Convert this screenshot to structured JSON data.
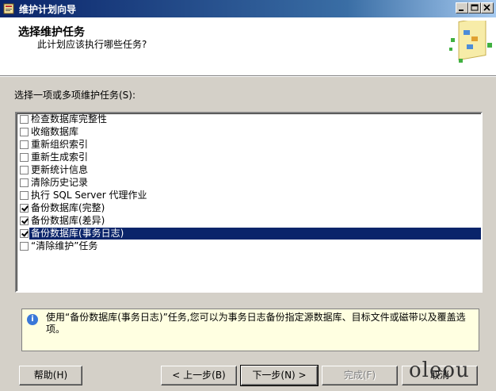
{
  "window": {
    "title": "维护计划向导"
  },
  "header": {
    "title": "选择维护任务",
    "subtitle": "此计划应该执行哪些任务?"
  },
  "section_label": "选择一项或多项维护任务(S):",
  "tasks": [
    {
      "label": "检查数据库完整性",
      "checked": false,
      "selected": false
    },
    {
      "label": "收缩数据库",
      "checked": false,
      "selected": false
    },
    {
      "label": "重新组织索引",
      "checked": false,
      "selected": false
    },
    {
      "label": "重新生成索引",
      "checked": false,
      "selected": false
    },
    {
      "label": "更新统计信息",
      "checked": false,
      "selected": false
    },
    {
      "label": "清除历史记录",
      "checked": false,
      "selected": false
    },
    {
      "label": "执行 SQL Server 代理作业",
      "checked": false,
      "selected": false
    },
    {
      "label": "备份数据库(完整)",
      "checked": true,
      "selected": false
    },
    {
      "label": "备份数据库(差异)",
      "checked": true,
      "selected": false
    },
    {
      "label": "备份数据库(事务日志)",
      "checked": true,
      "selected": true
    },
    {
      "label": "“清除维护”任务",
      "checked": false,
      "selected": false
    }
  ],
  "info": {
    "icon": "info-icon",
    "text": "使用“备份数据库(事务日志)”任务,您可以为事务日志备份指定源数据库、目标文件或磁带以及覆盖选项。"
  },
  "buttons": {
    "help": "帮助(H)",
    "back": "< 上一步(B)",
    "next": "下一步(N) >",
    "finish": "完成(F)",
    "cancel": "取消"
  },
  "watermark": "oleou",
  "colors": {
    "titlebar": "#0a246a",
    "selection": "#0a246a",
    "info_background": "#ffffe1",
    "dialog_background": "#d4d0c8"
  }
}
